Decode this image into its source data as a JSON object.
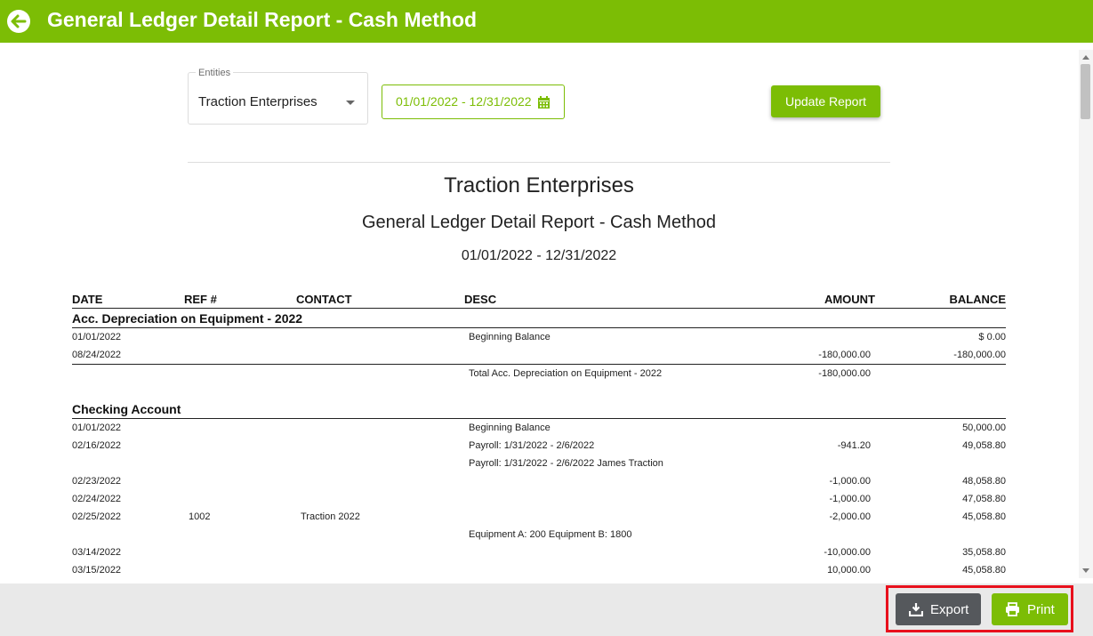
{
  "header": {
    "title": "General Ledger Detail Report - Cash Method",
    "back_icon": "back-arrow-icon"
  },
  "filters": {
    "entities_label": "Entities",
    "entities_value": "Traction Enterprises",
    "date_range": "01/01/2022 - 12/31/2022",
    "update_label": "Update Report"
  },
  "report": {
    "company": "Traction Enterprises",
    "title": "General Ledger Detail Report - Cash Method",
    "period": "01/01/2022 - 12/31/2022",
    "columns": {
      "date": "DATE",
      "ref": "REF #",
      "contact": "CONTACT",
      "desc": "DESC",
      "amount": "AMOUNT",
      "balance": "BALANCE"
    },
    "sections": [
      {
        "title": "Acc. Depreciation on Equipment - 2022",
        "rows": [
          {
            "date": "01/01/2022",
            "ref": "",
            "contact": "",
            "desc": "Beginning Balance",
            "amount": "",
            "balance": "$ 0.00"
          },
          {
            "date": "08/24/2022",
            "ref": "",
            "contact": "",
            "desc": "",
            "amount": "-180,000.00",
            "balance": "-180,000.00"
          }
        ],
        "total": {
          "desc": "Total Acc. Depreciation on Equipment - 2022",
          "amount": "-180,000.00"
        }
      },
      {
        "title": "Checking Account",
        "rows": [
          {
            "date": "01/01/2022",
            "ref": "",
            "contact": "",
            "desc": "Beginning Balance",
            "amount": "",
            "balance": "50,000.00"
          },
          {
            "date": "02/16/2022",
            "ref": "",
            "contact": "",
            "desc": "Payroll: 1/31/2022 - 2/6/2022",
            "amount": "-941.20",
            "balance": "49,058.80"
          },
          {
            "date": "",
            "ref": "",
            "contact": "",
            "desc": "Payroll: 1/31/2022 - 2/6/2022 James Traction",
            "amount": "",
            "balance": ""
          },
          {
            "date": "02/23/2022",
            "ref": "",
            "contact": "",
            "desc": "",
            "amount": "-1,000.00",
            "balance": "48,058.80"
          },
          {
            "date": "02/24/2022",
            "ref": "",
            "contact": "",
            "desc": "",
            "amount": "-1,000.00",
            "balance": "47,058.80"
          },
          {
            "date": "02/25/2022",
            "ref": "1002",
            "contact": "Traction 2022",
            "desc": "",
            "amount": "-2,000.00",
            "balance": "45,058.80"
          },
          {
            "date": "",
            "ref": "",
            "contact": "",
            "desc": "Equipment A: 200 Equipment B: 1800",
            "amount": "",
            "balance": ""
          },
          {
            "date": "03/14/2022",
            "ref": "",
            "contact": "",
            "desc": "",
            "amount": "-10,000.00",
            "balance": "35,058.80"
          },
          {
            "date": "03/15/2022",
            "ref": "",
            "contact": "",
            "desc": "",
            "amount": "10,000.00",
            "balance": "45,058.80"
          }
        ]
      }
    ]
  },
  "footer": {
    "export_label": "Export",
    "print_label": "Print"
  },
  "colors": {
    "brand": "#7cbd05",
    "export_bg": "#55585c",
    "highlight": "#e8101c"
  }
}
